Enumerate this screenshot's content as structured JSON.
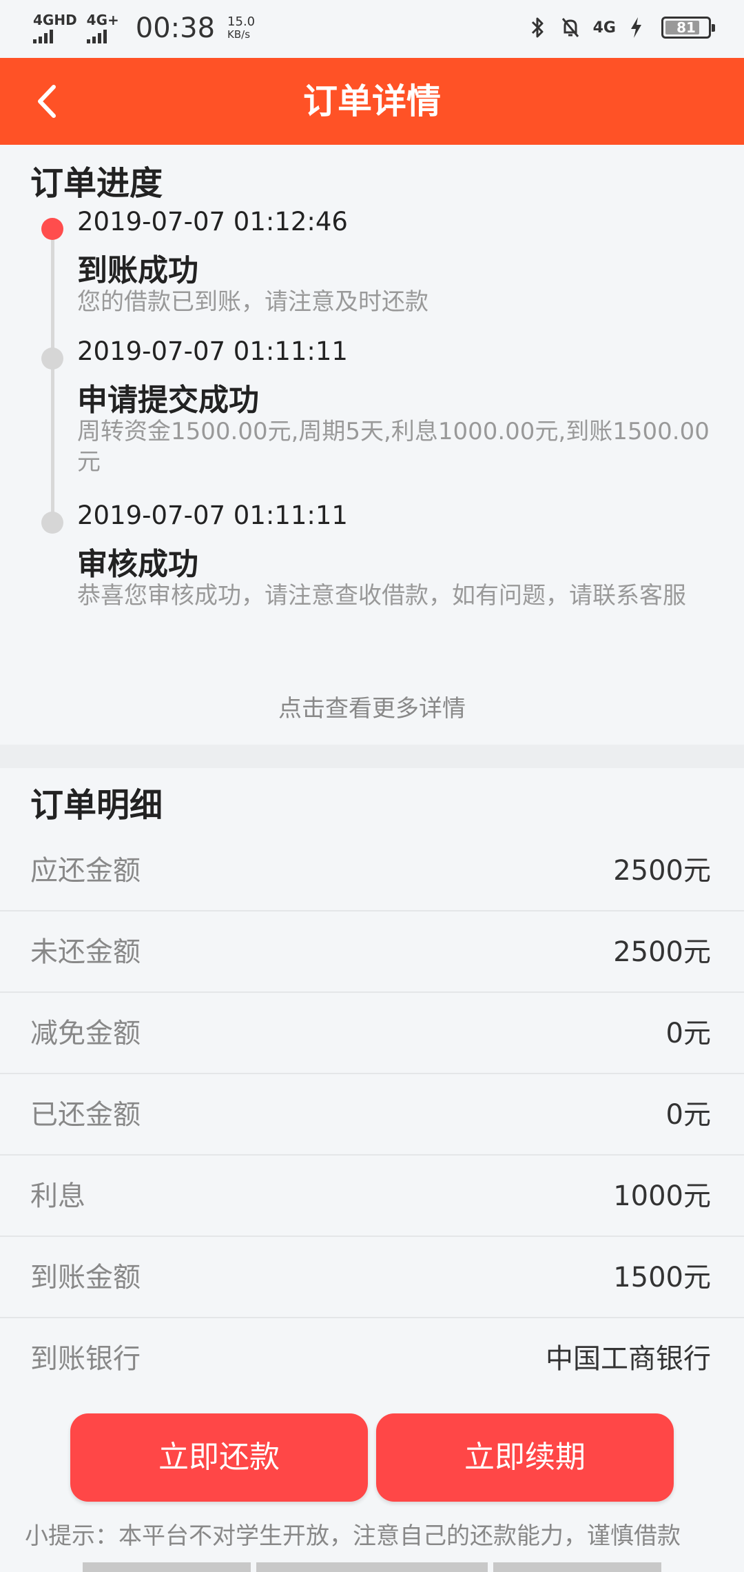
{
  "status_bar": {
    "signal1": "4GHD",
    "signal2": "4G+",
    "time": "00:38",
    "speed_value": "15.0",
    "speed_unit": "KB/s",
    "net_right": "4G",
    "battery": "81"
  },
  "header": {
    "title": "订单详情",
    "back_icon": "chevron-left-icon"
  },
  "progress": {
    "title": "订单进度",
    "items": [
      {
        "time": "2019-07-07 01:12:46",
        "title": "到账成功",
        "desc": "您的借款已到账，请注意及时还款",
        "active": true
      },
      {
        "time": "2019-07-07 01:11:11",
        "title": "申请提交成功",
        "desc": "周转资金1500.00元,周期5天,利息1000.00元,到账1500.00元",
        "active": false
      },
      {
        "time": "2019-07-07 01:11:11",
        "title": "审核成功",
        "desc": "恭喜您审核成功，请注意查收借款，如有问题，请联系客服",
        "active": false
      }
    ],
    "more": "点击查看更多详情"
  },
  "details": {
    "title": "订单明细",
    "rows": [
      {
        "label": "应还金额",
        "value": "2500元"
      },
      {
        "label": "未还金额",
        "value": "2500元"
      },
      {
        "label": "减免金额",
        "value": "0元"
      },
      {
        "label": "已还金额",
        "value": "0元"
      },
      {
        "label": "利息",
        "value": "1000元"
      },
      {
        "label": "到账金额",
        "value": "1500元"
      },
      {
        "label": "到账银行",
        "value": "中国工商银行"
      }
    ]
  },
  "actions": {
    "repay": "立即还款",
    "extend": "立即续期"
  },
  "tip": "小提示：本平台不对学生开放，注意自己的还款能力，谨慎借款",
  "colors": {
    "header": "#ff5226",
    "button": "#ff4747",
    "active_dot": "#ff4d4d"
  }
}
